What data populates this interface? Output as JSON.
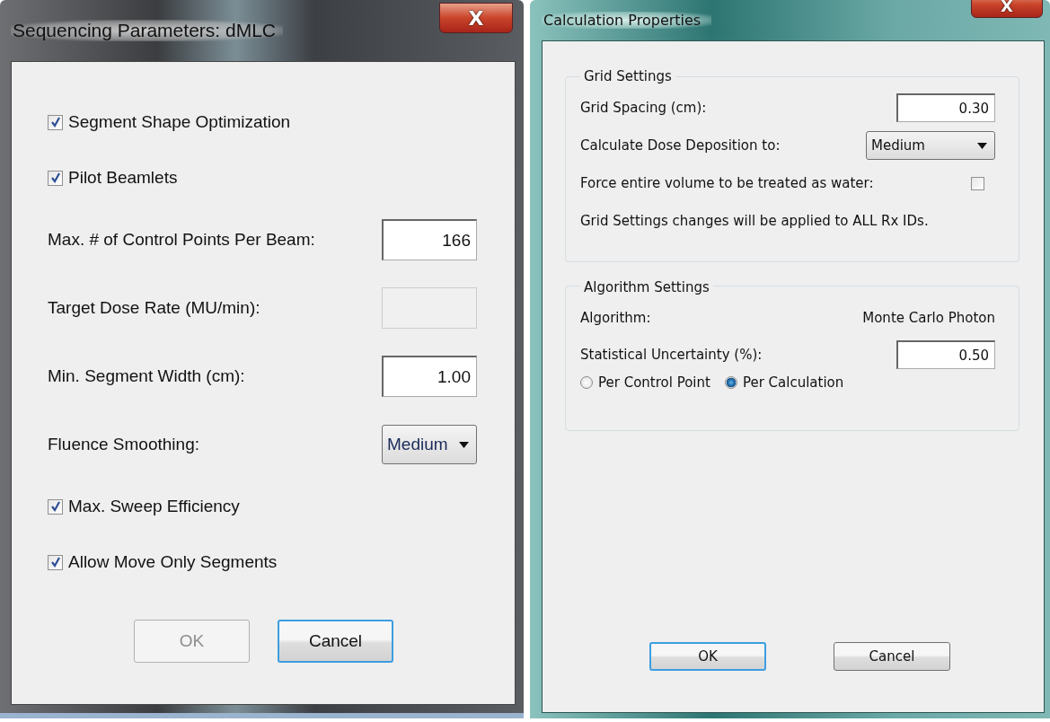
{
  "dialogs": [
    {
      "title": "Sequencing Parameters: dMLC",
      "close": "X",
      "sections": [
        {
          "rows": [
            {
              "kind": "checkbox",
              "label": "Segment Shape Optimization",
              "checked": true
            },
            {
              "kind": "checkbox",
              "label": "Pilot Beamlets",
              "checked": true
            },
            {
              "kind": "field",
              "label": "Max. # of Control Points Per Beam:",
              "value": "166",
              "disabled": false
            },
            {
              "kind": "field",
              "label": "Target Dose Rate (MU/min):",
              "disabled": true
            },
            {
              "kind": "field",
              "label": "Min. Segment Width (cm):",
              "value": "1.00",
              "disabled": false
            },
            {
              "kind": "dropdown",
              "label": "Fluence Smoothing:",
              "value": "Medium"
            },
            {
              "kind": "checkbox",
              "label": "Max. Sweep Efficiency",
              "checked": true
            },
            {
              "kind": "checkbox",
              "label": "Allow Move Only Segments",
              "checked": true
            }
          ]
        }
      ],
      "buttons": [
        {
          "label": "OK",
          "disabled": true,
          "default": false
        },
        {
          "label": "Cancel",
          "disabled": false,
          "default": true
        }
      ]
    },
    {
      "title": "Calculation Properties",
      "close": "X",
      "sections": [
        {
          "title": "Grid Settings",
          "rows": [
            {
              "kind": "field",
              "label": "Grid Spacing (cm):",
              "value": "0.30",
              "disabled": false
            },
            {
              "kind": "dropdown",
              "label": "Calculate Dose Deposition to:",
              "value": "Medium"
            },
            {
              "kind": "checkbox",
              "label": "Force entire volume to be treated as water:",
              "checked": false
            },
            {
              "kind": "note",
              "label": "Grid Settings changes will be applied to ALL Rx IDs."
            }
          ]
        },
        {
          "title": "Algorithm Settings",
          "rows": [
            {
              "kind": "info",
              "label": "Algorithm:",
              "value": "Monte Carlo Photon"
            },
            {
              "kind": "field",
              "label": "Statistical Uncertainty (%):",
              "value": "0.50",
              "disabled": false
            },
            {
              "kind": "radios",
              "options": [
                {
                  "label": "Per Control Point",
                  "selected": false
                },
                {
                  "label": "Per Calculation",
                  "selected": true
                }
              ]
            }
          ]
        }
      ],
      "buttons": [
        {
          "label": "OK",
          "disabled": false,
          "default": true
        },
        {
          "label": "Cancel",
          "disabled": false,
          "default": false
        }
      ]
    }
  ]
}
